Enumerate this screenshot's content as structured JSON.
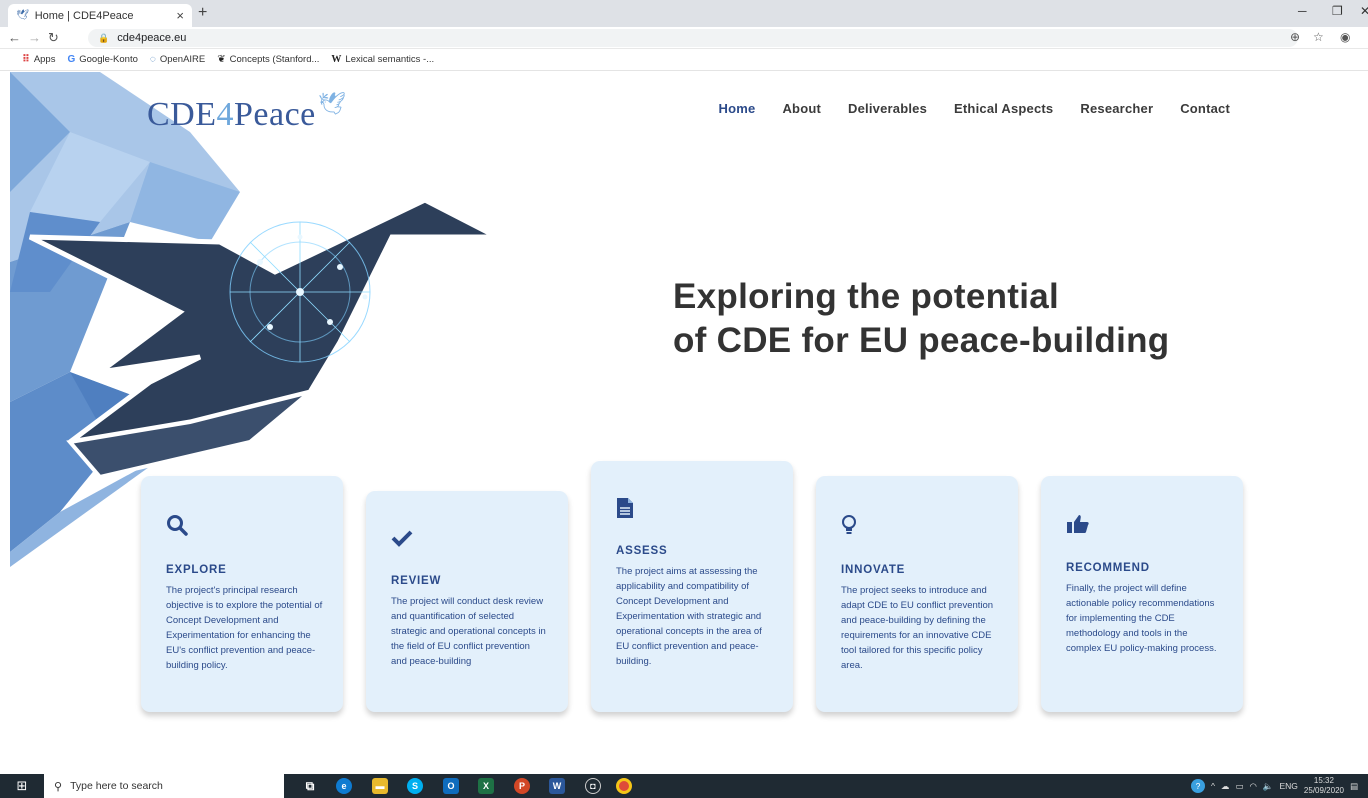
{
  "browser": {
    "tab_title": "Home | CDE4Peace",
    "tab_close": "×",
    "new_tab": "+",
    "url": "cde4peace.eu",
    "bookmarks": [
      {
        "icon": "apps-grid-icon",
        "label": "Apps"
      },
      {
        "icon": "google-icon",
        "label": "Google-Konto"
      },
      {
        "icon": "openaire-icon",
        "label": "OpenAIRE"
      },
      {
        "icon": "feather-icon",
        "label": "Concepts (Stanford..."
      },
      {
        "icon": "wikipedia-icon",
        "label": "Lexical semantics -..."
      }
    ]
  },
  "site": {
    "logo_left": "CDE",
    "logo_four": "4",
    "logo_right": "Peace",
    "nav": [
      "Home",
      "About",
      "Deliverables",
      "Ethical Aspects",
      "Researcher",
      "Contact"
    ],
    "hero_line1": "Exploring the potential",
    "hero_line2": "of CDE for EU peace-building"
  },
  "cards": [
    {
      "icon": "search-icon",
      "title": "EXPLORE",
      "text": "The project's principal research objective is to explore the potential of Concept Development and Experimentation for enhancing the EU's conflict prevention and peace-building policy."
    },
    {
      "icon": "checkmark-icon",
      "title": "REVIEW",
      "text": "The project will conduct desk review and quantification of selected strategic and operational concepts in the field of EU conflict prevention and peace-building"
    },
    {
      "icon": "document-icon",
      "title": "ASSESS",
      "text": "The project aims at assessing the applicability and compatibility of Concept Development and Experimentation with strategic and operational concepts in the area of EU conflict prevention and peace-building."
    },
    {
      "icon": "lightbulb-icon",
      "title": "INNOVATE",
      "text": "The project seeks to introduce and adapt CDE to EU conflict prevention and peace-building by defining the requirements for an innovative CDE tool tailored for this specific policy area."
    },
    {
      "icon": "thumbs-up-icon",
      "title": "RECOMMEND",
      "text": "Finally, the project will define actionable policy recommendations for implementing the CDE methodology and tools in the complex EU policy-making process."
    }
  ],
  "taskbar": {
    "search_placeholder": "Type here to search",
    "lang": "ENG",
    "time": "15:32",
    "date": "25/09/2020"
  }
}
